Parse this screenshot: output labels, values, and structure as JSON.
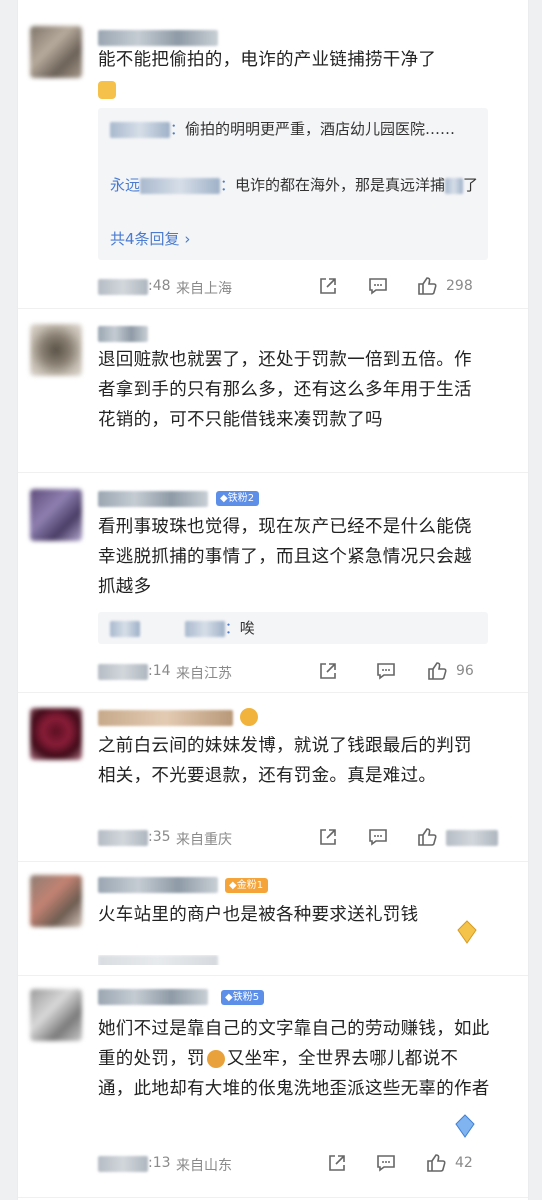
{
  "comments": [
    {
      "text": "能不能把偷拍的，电诈的产业链捕捞干净了",
      "replies": [
        {
          "author_fragment": "：",
          "text": "偷拍的明明更严重，酒店幼儿园医院……"
        },
        {
          "author_prefix": "永远",
          "author_fragment": "：",
          "text": "电诈的都在海外，那是真远洋捕",
          "tail": "了"
        }
      ],
      "more_replies": "共4条回复",
      "time": ":48",
      "location": "来自上海",
      "likes": "298"
    },
    {
      "text": "退回赃款也就罢了，还处于罚款一倍到五倍。作者拿到手的只有那么多，还有这么多年用于生活花销的，可不只能借钱来凑罚款了吗"
    },
    {
      "badge": "铁粉2",
      "text": "看刑事玻珠也觉得，现在灰产已经不是什么能侥幸逃脱抓捕的事情了，而且这个紧急情况只会越抓越多",
      "replies": [
        {
          "author_fragment": "：",
          "text": "唉"
        }
      ],
      "time": ":14",
      "location": "来自江苏",
      "likes": "96"
    },
    {
      "text": "之前白云间的妹妹发博，就说了钱跟最后的判罚相关，不光要退款，还有罚金。真是难过。",
      "time": ":35",
      "location": "来自重庆"
    },
    {
      "badge": "金粉1",
      "text": "火车站里的商户也是被各种要求送礼罚钱"
    },
    {
      "badge": "铁粉5",
      "text_a": "她们不过是靠自己的文字靠自己的劳动赚钱，如此重的处罚，罚",
      "text_b": "又坐牢，全世界去哪儿都说不通，此地却有大堆的伥鬼洗地歪派这些无辜的作者",
      "time": ":13",
      "location": "来自山东",
      "likes": "42"
    }
  ],
  "icons": [
    "share-icon",
    "comment-icon",
    "like-icon"
  ],
  "colors": {
    "link": "#4a7bd0",
    "badge_blue": "#5d8fe8",
    "badge_gold": "#f5a43a"
  }
}
